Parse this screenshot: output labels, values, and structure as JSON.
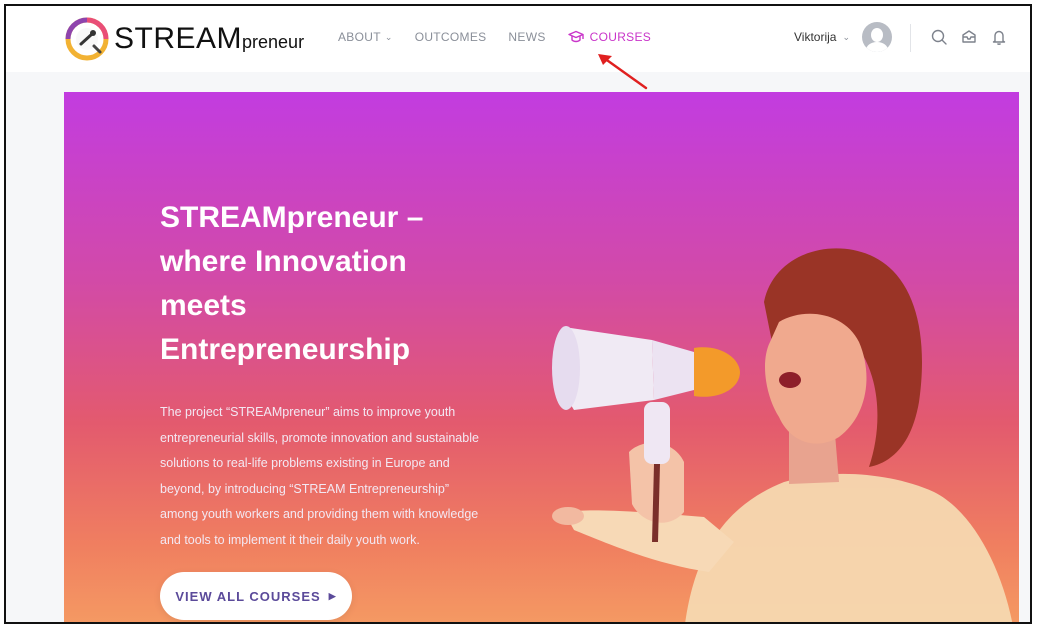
{
  "logo": {
    "text_main": "STREAM",
    "text_suffix": "preneur"
  },
  "nav": {
    "items": [
      {
        "label": "ABOUT",
        "has_dropdown": true,
        "active": false
      },
      {
        "label": "OUTCOMES",
        "has_dropdown": false,
        "active": false
      },
      {
        "label": "NEWS",
        "has_dropdown": false,
        "active": false
      },
      {
        "label": "COURSES",
        "has_dropdown": false,
        "active": true,
        "icon": "graduation-cap-icon"
      }
    ]
  },
  "user": {
    "name": "Viktorija"
  },
  "header_icons": [
    "search-icon",
    "inbox-icon",
    "bell-icon"
  ],
  "hero": {
    "title_lines": [
      "STREAMpreneur –",
      "where Innovation",
      "meets",
      "Entrepreneurship"
    ],
    "description_lines": [
      "The project “STREAMpreneur” aims to improve youth",
      "entrepreneurial skills, promote innovation and sustainable",
      "solutions to real-life problems existing in Europe and",
      "beyond, by introducing “STREAM Entrepreneurship”",
      "among youth workers and providing them with knowledge",
      "and tools to implement it their daily youth work."
    ],
    "cta_label": "VIEW ALL COURSES"
  },
  "colors": {
    "accent": "#c935c9",
    "annotation_arrow": "#e02020",
    "hero_gradient_top": "#c23ce0",
    "hero_gradient_bottom": "#f59a63"
  }
}
